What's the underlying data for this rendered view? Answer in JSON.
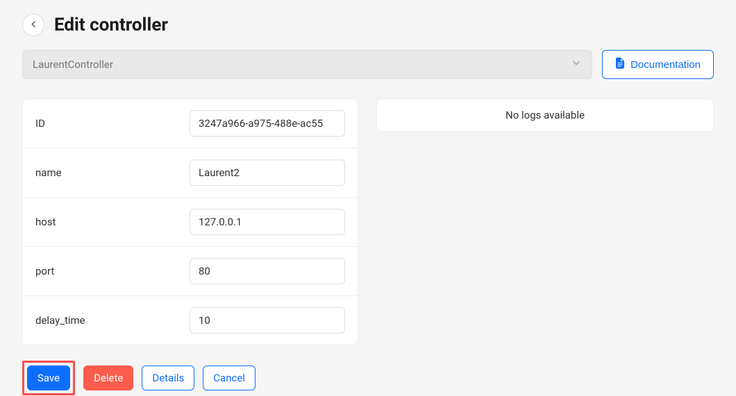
{
  "header": {
    "title": "Edit controller"
  },
  "top": {
    "controller_name": "LaurentController",
    "documentation_label": "Documentation"
  },
  "form": {
    "fields": [
      {
        "label": "ID",
        "value": "3247a966-a975-488e-ac55"
      },
      {
        "label": "name",
        "value": "Laurent2"
      },
      {
        "label": "host",
        "value": "127.0.0.1"
      },
      {
        "label": "port",
        "value": "80"
      },
      {
        "label": "delay_time",
        "value": "10"
      }
    ]
  },
  "logs": {
    "empty_text": "No logs available"
  },
  "actions": {
    "save": "Save",
    "delete": "Delete",
    "details": "Details",
    "cancel": "Cancel"
  }
}
